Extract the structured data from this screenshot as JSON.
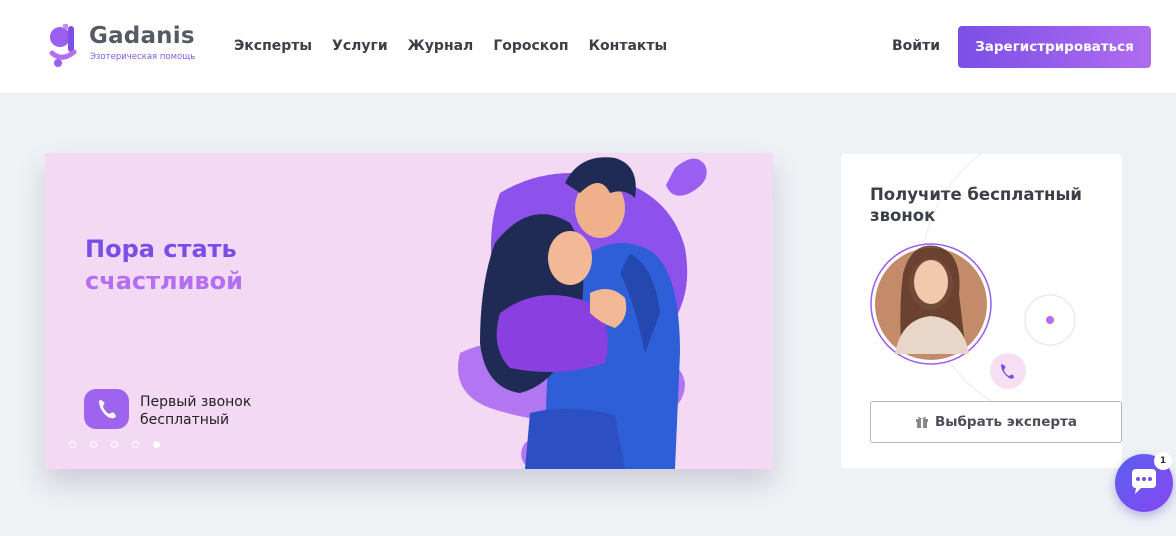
{
  "brand": {
    "name": "Gadanis",
    "tagline": "Эзотерическая помощь",
    "accent": "#7b4fe6"
  },
  "nav": {
    "items": [
      {
        "label": "Эксперты"
      },
      {
        "label": "Услуги"
      },
      {
        "label": "Журнал"
      },
      {
        "label": "Гороскоп"
      },
      {
        "label": "Контакты"
      }
    ],
    "login_label": "Войти",
    "register_label": "Зарегистрироваться"
  },
  "hero": {
    "title_line1": "Пора стать",
    "title_line2": "счастливой",
    "call_line1": "Первый звонок",
    "call_line2": "бесплатный",
    "slides_count": 5,
    "active_slide": 5,
    "icons": [
      "phone-icon",
      "couple-illustration"
    ]
  },
  "callback_card": {
    "title": "Получите бесплатный звонок",
    "button_label": "Выбрать эксперта",
    "icons": [
      "gift-icon",
      "expert-avatar",
      "phone-icon"
    ]
  },
  "chat": {
    "badge_count": "1",
    "icon": "chat-bubble-icon"
  }
}
